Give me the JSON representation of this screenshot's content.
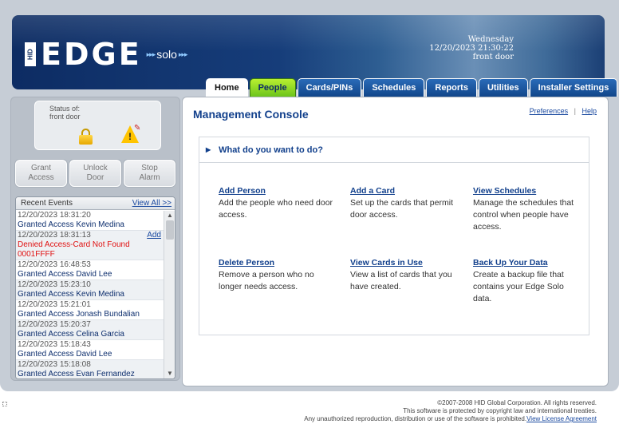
{
  "header": {
    "logo_hid": "HID",
    "logo_edge": "EDGE",
    "logo_solo": "solo",
    "day": "Wednesday",
    "datetime": "12/20/2023 21:30:22",
    "door": "front door"
  },
  "tabs": [
    {
      "label": "Home"
    },
    {
      "label": "People"
    },
    {
      "label": "Cards/PINs"
    },
    {
      "label": "Schedules"
    },
    {
      "label": "Reports"
    },
    {
      "label": "Utilities"
    },
    {
      "label": "Installer Settings"
    }
  ],
  "status": {
    "label_line1": "Status of:",
    "label_line2": "front door"
  },
  "controls": {
    "grant": [
      "Grant",
      "Access"
    ],
    "unlock": [
      "Unlock",
      "Door"
    ],
    "stop": [
      "Stop",
      "Alarm"
    ]
  },
  "events": {
    "title": "Recent Events",
    "view_all": "View All >>",
    "add_label": "Add",
    "items": [
      {
        "time": "12/20/2023 18:31:20",
        "text": "Granted Access Kevin Medina"
      },
      {
        "time": "12/20/2023 18:31:13",
        "text": "Denied Access-Card Not Found 0001FFFF"
      },
      {
        "time": "12/20/2023 16:48:53",
        "text": "Granted Access David Lee"
      },
      {
        "time": "12/20/2023 15:23:10",
        "text": "Granted Access Kevin Medina"
      },
      {
        "time": "12/20/2023 15:21:01",
        "text": "Granted Access Jonash Bundalian"
      },
      {
        "time": "12/20/2023 15:20:37",
        "text": "Granted Access Celina Garcia"
      },
      {
        "time": "12/20/2023 15:18:43",
        "text": "Granted Access David Lee"
      },
      {
        "time": "12/20/2023 15:18:08",
        "text": "Granted Access Evan Fernandez"
      }
    ]
  },
  "main": {
    "title": "Management Console",
    "preferences": "Preferences",
    "separator": "|",
    "help": "Help",
    "question": "What do you want to do?",
    "actions": {
      "add_person": {
        "title": "Add Person",
        "desc": "Add the people who need door access."
      },
      "add_card": {
        "title": "Add a Card",
        "desc": "Set up the cards that permit door access."
      },
      "view_schedules": {
        "title": "View Schedules",
        "desc": "Manage the schedules that control when people have access."
      },
      "delete_person": {
        "title": "Delete Person",
        "desc": "Remove a person who no longer needs access."
      },
      "view_cards": {
        "title": "View Cards in Use",
        "desc": "View a list of cards that you have created."
      },
      "backup": {
        "title": "Back Up Your Data",
        "desc": "Create a backup file that contains your Edge Solo data."
      }
    }
  },
  "footer": {
    "line1": "©2007-2008 HID Global Corporation. All rights reserved.",
    "line2": "This software is protected by copyright law and international treaties.",
    "line3": "Any unauthorized reproduction, distribution or use of the software is prohibited.",
    "license": "View License Agreement"
  }
}
